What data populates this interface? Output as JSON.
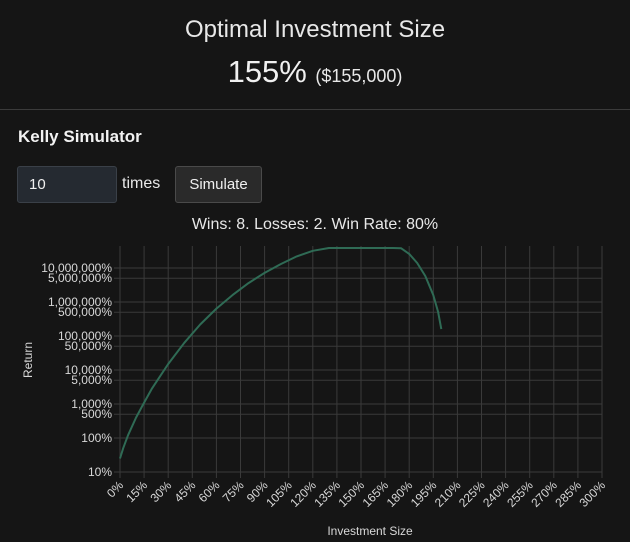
{
  "header": {
    "title": "Optimal Investment Size",
    "optimal_pct": "155%",
    "optimal_amount": "($155,000)"
  },
  "simulator": {
    "title": "Kelly Simulator",
    "times_value": "10",
    "times_label": "times",
    "simulate_label": "Simulate",
    "result_text": "Wins: 8. Losses: 2. Win Rate: 80%"
  },
  "colors": {
    "background": "#151515",
    "line": "#2f6b55",
    "grid": "#3a3a3a"
  },
  "chart_data": {
    "type": "line",
    "xlabel": "Investment Size",
    "ylabel": "Return",
    "x_ticks": [
      "0%",
      "15%",
      "30%",
      "45%",
      "60%",
      "75%",
      "90%",
      "105%",
      "120%",
      "135%",
      "150%",
      "165%",
      "180%",
      "195%",
      "210%",
      "225%",
      "240%",
      "255%",
      "270%",
      "285%",
      "300%"
    ],
    "y_scale": "log",
    "y_ticks": [
      {
        "value": 10,
        "label": "10%"
      },
      {
        "value": 100,
        "label": "100%"
      },
      {
        "value": 500,
        "label": "500%"
      },
      {
        "value": 1000,
        "label": "1,000%"
      },
      {
        "value": 5000,
        "label": "5,000%"
      },
      {
        "value": 10000,
        "label": "10,000%"
      },
      {
        "value": 50000,
        "label": "50,000%"
      },
      {
        "value": 100000,
        "label": "100,000%"
      },
      {
        "value": 500000,
        "label": "500,000%"
      },
      {
        "value": 1000000,
        "label": "1,000,000%"
      },
      {
        "value": 5000000,
        "label": "5,000,000%"
      },
      {
        "value": 10000000,
        "label": "10,000,000%"
      }
    ],
    "xlim": [
      0,
      300
    ],
    "ylim": [
      10,
      50000000
    ],
    "grid": true,
    "series": [
      {
        "x": [
          0,
          2,
          5,
          10,
          15,
          20,
          30,
          40,
          50,
          60,
          70,
          80,
          90,
          100,
          110,
          120,
          130,
          140,
          150,
          155,
          160,
          165,
          170,
          175,
          180,
          185,
          190,
          195,
          198,
          200
        ],
        "y": [
          25,
          50,
          120,
          400,
          1100,
          2900,
          15000,
          63000,
          220000,
          640000,
          1600000,
          3600000,
          7200000,
          13000000,
          22000000,
          32000000,
          43000000,
          53000000,
          58000000,
          60000000,
          58000000,
          55000000,
          48000000,
          38000000,
          26000000,
          14000000,
          5800000,
          1600000,
          510000,
          160000
        ]
      }
    ]
  }
}
